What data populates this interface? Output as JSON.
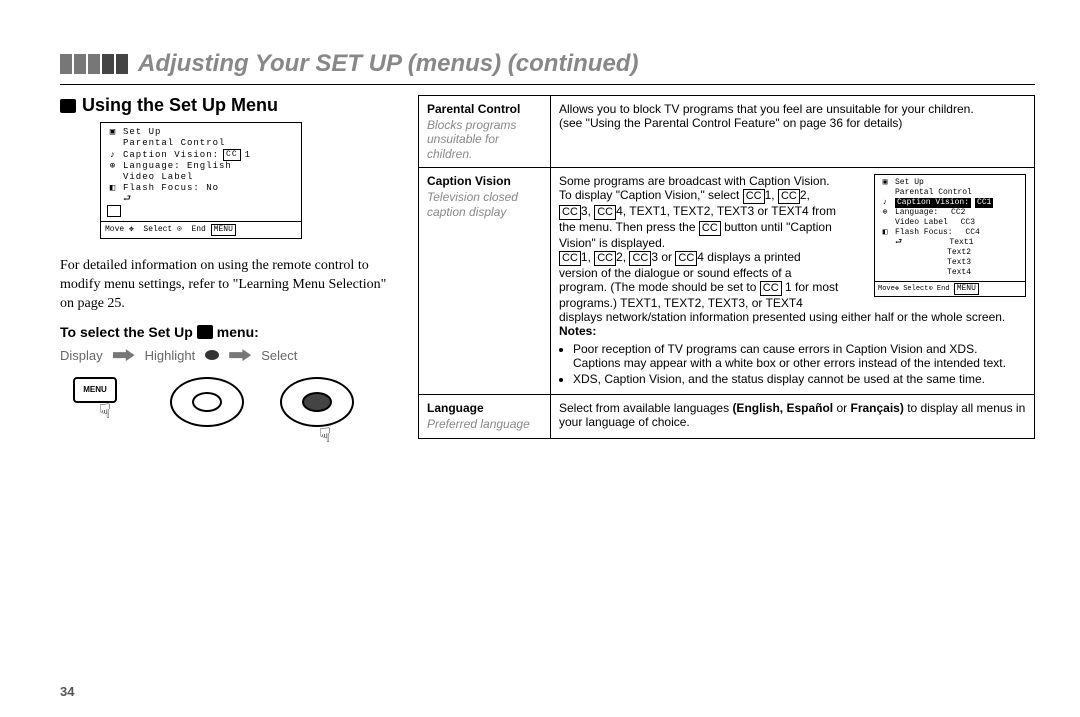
{
  "title": "Adjusting Your SET UP (menus) (continued)",
  "section_heading": "Using the Set Up Menu",
  "menu_shot": {
    "title": "Set Up",
    "rows": [
      "Parental Control",
      "Caption Vision:",
      "Language:   English",
      "Video Label",
      "Flash Focus:    No"
    ],
    "cc_label": "CC",
    "cc_num": "1",
    "footer_move": "Move",
    "footer_select": "Select",
    "footer_end": "End",
    "footer_menu": "MENU"
  },
  "intro": "For detailed information on using the remote control to modify menu settings, refer to \"Learning Menu Selection\" on page 25.",
  "subheading_a": "To select the Set Up",
  "subheading_b": "menu:",
  "flow": {
    "display": "Display",
    "highlight": "Highlight",
    "select": "Select"
  },
  "menu_key": "MENU",
  "table": {
    "parental": {
      "label": "Parental Control",
      "sub": "Blocks programs unsuitable for children.",
      "body1": "Allows you to block TV programs that you feel are unsuitable for your children.",
      "body2": "(see \"Using the Parental Control Feature\" on page 36 for details)"
    },
    "caption": {
      "label": "Caption Vision",
      "sub": "Television closed caption display",
      "l1": "Some programs are broadcast with Caption Vision.",
      "l2a": "To display \"Caption Vision,\" select ",
      "l2b": "1, ",
      "l2c": "2,",
      "l3a": "3, ",
      "l3b": "4, TEXT1, TEXT2, TEXT3 or TEXT4 from",
      "l4a": "the menu. Then press the ",
      "l4b": " button until \"Caption",
      "l5": "Vision\" is displayed.",
      "l6a": "1, ",
      "l6b": "2, ",
      "l6c": "3 or ",
      "l6d": "4 displays a printed",
      "l7": "version of the dialogue or sound effects of a",
      "l8a": "program. (The mode should be set to ",
      "l8b": "1 for most",
      "l9": "programs.) TEXT1, TEXT2, TEXT3, or TEXT4",
      "l10": "displays network/station information presented using either half or the whole screen.",
      "notes_label": "Notes:",
      "note1": "Poor reception of TV programs can cause errors in Caption Vision and XDS. Captions may appear with a white box or other errors instead of the intended text.",
      "note2": "XDS, Caption Vision, and the status display cannot be used at the same time.",
      "mini": {
        "title": "Set Up",
        "r1": "Parental Control",
        "r2": "Caption Vision:",
        "r2cc": "CC1",
        "r3": "Language:",
        "r3v": "CC2",
        "r4": "Video Label",
        "r4v": "CC3",
        "r5": "Flash Focus:",
        "r5v": "CC4",
        "t1": "Text1",
        "t2": "Text2",
        "t3": "Text3",
        "t4": "Text4",
        "fmove": "Move",
        "fselect": "Select",
        "fend": "End",
        "fmenu": "MENU"
      }
    },
    "language": {
      "label": "Language",
      "sub": "Preferred language",
      "body_a": "Select from available languages ",
      "body_b": "(English, Español",
      "body_c": " or ",
      "body_d": "Français)",
      "body_e": " to display all menus in your language of choice."
    }
  },
  "page_num": "34"
}
